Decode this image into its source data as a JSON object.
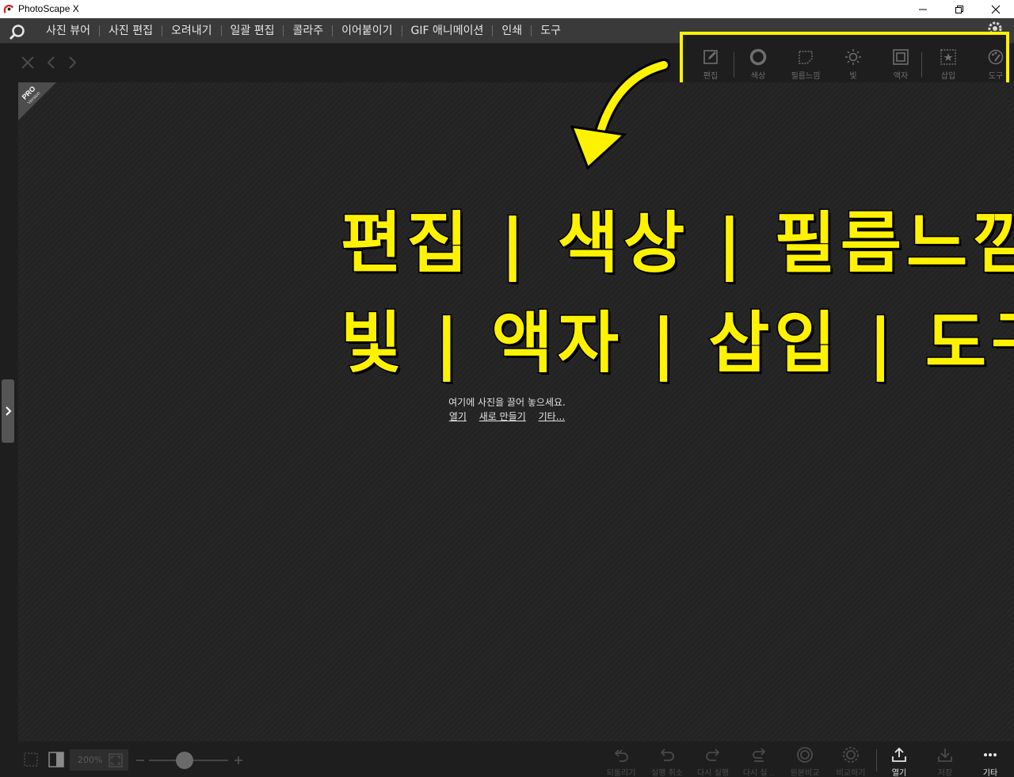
{
  "window": {
    "title": "PhotoScape X"
  },
  "menu": {
    "items": [
      "사진 뷰어",
      "사진 편집",
      "오려내기",
      "일괄 편집",
      "콜라주",
      "이어붙이기",
      "GIF 애니메이션",
      "인쇄",
      "도구"
    ]
  },
  "tools": {
    "items": [
      {
        "label": "편집",
        "icon": "edit-icon"
      },
      {
        "label": "색상",
        "icon": "color-icon"
      },
      {
        "label": "필름느낌",
        "icon": "film-icon"
      },
      {
        "label": "빛",
        "icon": "light-icon"
      },
      {
        "label": "액자",
        "icon": "frame-icon"
      },
      {
        "label": "삽입",
        "icon": "insert-icon"
      },
      {
        "label": "도구",
        "icon": "tools-icon"
      }
    ],
    "highlight_color": "#fff200"
  },
  "badge": {
    "line1": "PRO",
    "line2": "Version"
  },
  "overlay": {
    "row1": "편집 | 색상 | 필름느낌",
    "row2": "빛 | 액자 | 삽입 | 도구",
    "color": "#fff200"
  },
  "canvas": {
    "hint": "여기에 사진을 끌어 놓으세요.",
    "links": [
      "열기",
      "새로 만들기",
      "기타..."
    ]
  },
  "bottom": {
    "zoom": "200%",
    "actions": [
      {
        "label": "되돌리기",
        "icon": "revert-icon"
      },
      {
        "label": "실행 취소",
        "icon": "undo-icon"
      },
      {
        "label": "다시 실행",
        "icon": "redo-icon"
      },
      {
        "label": "다시 실 ..",
        "icon": "redo-all-icon"
      },
      {
        "label": "원본비교",
        "icon": "compare-original-icon"
      },
      {
        "label": "비교하기",
        "icon": "compare-icon"
      },
      {
        "label": "열기",
        "icon": "open-icon"
      },
      {
        "label": "저장",
        "icon": "save-icon"
      },
      {
        "label": "기타",
        "icon": "more-icon"
      }
    ]
  }
}
